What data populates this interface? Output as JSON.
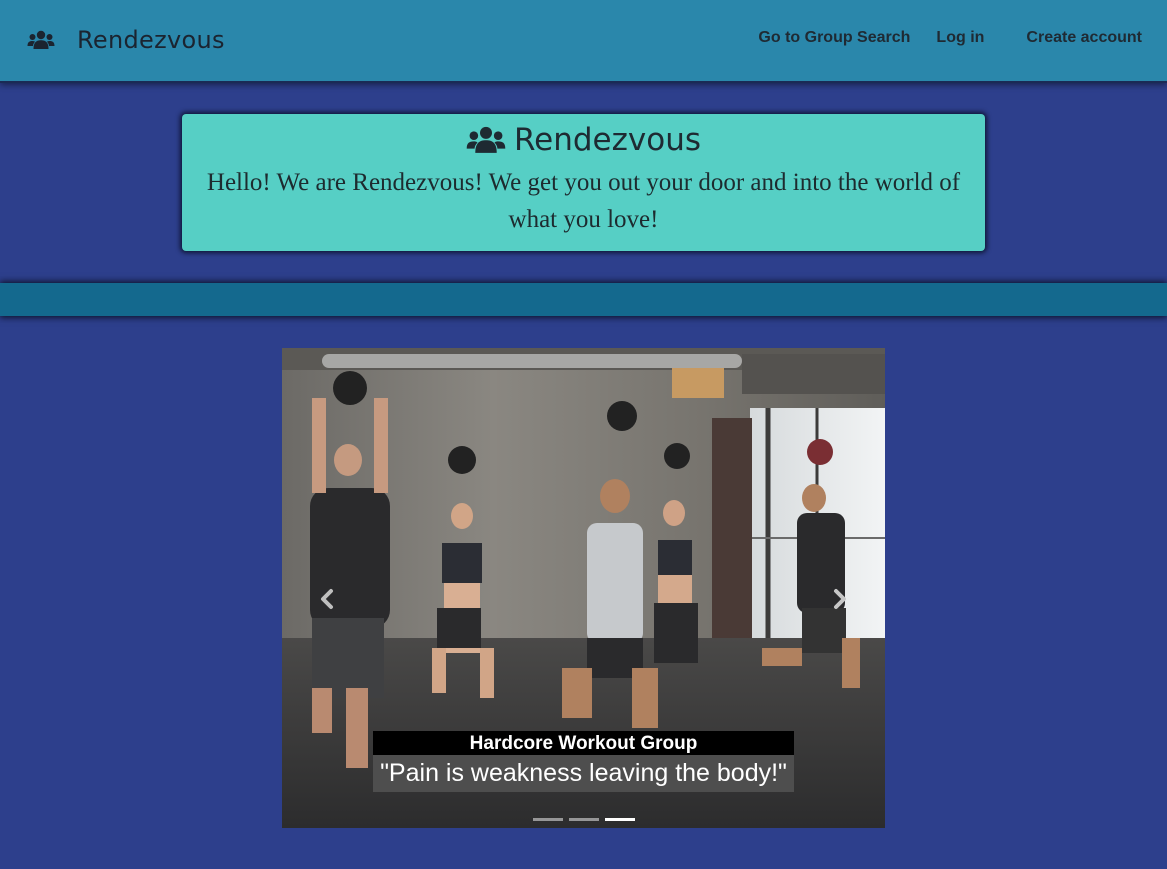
{
  "navbar": {
    "brand": "Rendezvous",
    "brand_icon": "users-icon",
    "links": {
      "group_search": "Go to Group Search",
      "login": "Log in",
      "create_account": "Create account"
    }
  },
  "hero": {
    "title": "Rendezvous",
    "title_icon": "users-icon",
    "tagline": "Hello! We are Rendezvous! We get you out your door and into the world of what you love!"
  },
  "carousel": {
    "prev_icon": "chevron-left-icon",
    "next_icon": "chevron-right-icon",
    "caption_title": "Hardcore Workout Group",
    "caption_quote": "\"Pain is weakness leaving the body!\"",
    "slide_count": 3,
    "active_index": 2
  },
  "colors": {
    "page_background": "#2d3f8c",
    "navbar": "#2a87ab",
    "hero_box": "#56cfc5",
    "divider_band": "#14698e"
  }
}
